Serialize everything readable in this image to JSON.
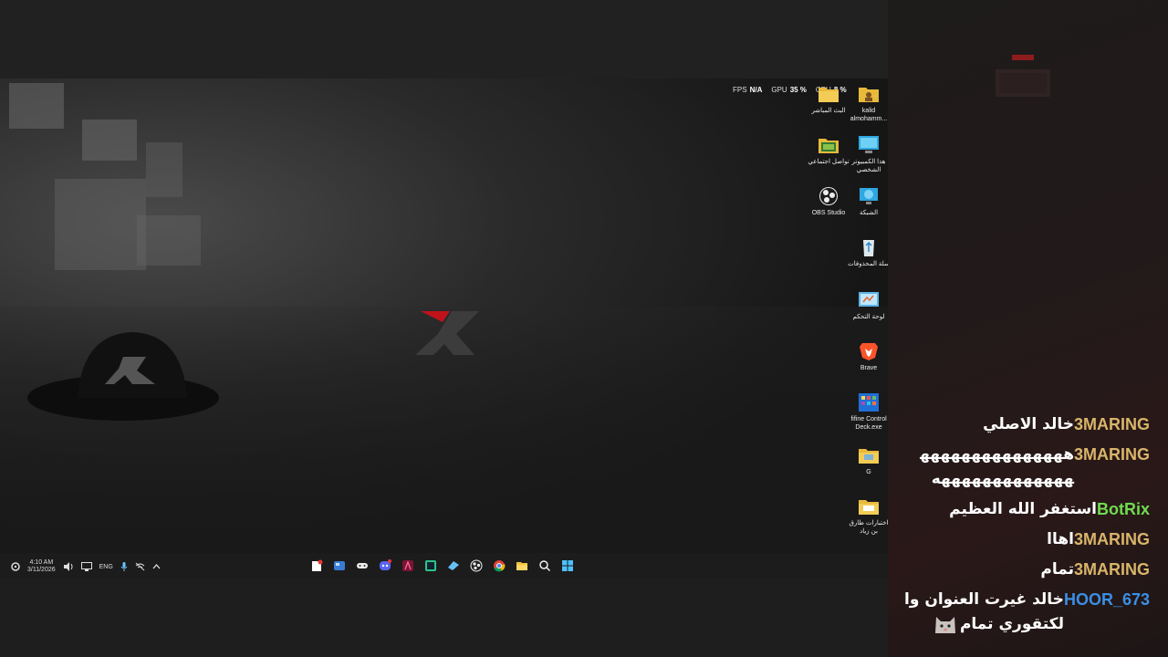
{
  "overlay": {
    "fps_label": "FPS",
    "fps_value": "N/A",
    "gpu_label": "GPU",
    "gpu_value": "35 %",
    "cpu_label": "CPU",
    "cpu_value": "8 %"
  },
  "desktop_icons": [
    {
      "label": "kalid almohamm...",
      "icon": "folder-user-icon"
    },
    {
      "label": "البث المباشر",
      "icon": "folder-icon"
    },
    {
      "label": "هذا الكمبيوتر الشخصي",
      "icon": "computer-icon"
    },
    {
      "label": "تواصل اجتماعي",
      "icon": "folder-icon"
    },
    {
      "label": "الشبكة",
      "icon": "network-icon"
    },
    {
      "label": "OBS Studio",
      "icon": "obs-icon"
    },
    {
      "label": "سلة المحذوفات",
      "icon": "recycle-bin-icon"
    },
    {
      "label": "لوحة التحكم",
      "icon": "control-panel-icon"
    },
    {
      "label": "Brave",
      "icon": "brave-icon"
    },
    {
      "label": "fifine Control Deck.exe",
      "icon": "app-grid-icon"
    },
    {
      "label": "G",
      "icon": "folder-icon"
    },
    {
      "label": "اختبارات طارق بن زياد",
      "icon": "folder-icon"
    }
  ],
  "taskbar": {
    "time": "4:10 AM",
    "date": "3/11/2026",
    "language": "ENG",
    "apps": [
      "notes-icon",
      "widgets-icon",
      "gamepad-icon",
      "discord-icon",
      "affinity-icon",
      "terminal-icon",
      "steam-icon",
      "obs-icon",
      "chrome-icon",
      "file-explorer-icon",
      "search-icon",
      "start-icon"
    ]
  },
  "chat": {
    "messages": [
      {
        "user": "3MARING",
        "text": "خالد الاصلي",
        "color": "#d9b56a"
      },
      {
        "user": "3MARING",
        "text": "ههههههههههههههههههههههههههههه",
        "color": "#d9b56a"
      },
      {
        "user": "BotRix",
        "text": "استغفر الله العظيم",
        "color": "#6fdc4f"
      },
      {
        "user": "3MARING",
        "text": "اهاا",
        "color": "#d9b56a"
      },
      {
        "user": "3MARING",
        "text": "تمام",
        "color": "#d9b56a"
      },
      {
        "user": "HOOR_673",
        "text": "خالد غيرت العنوان والكتقوري تمام",
        "color": "#3b8fe6",
        "emote": true
      }
    ]
  }
}
